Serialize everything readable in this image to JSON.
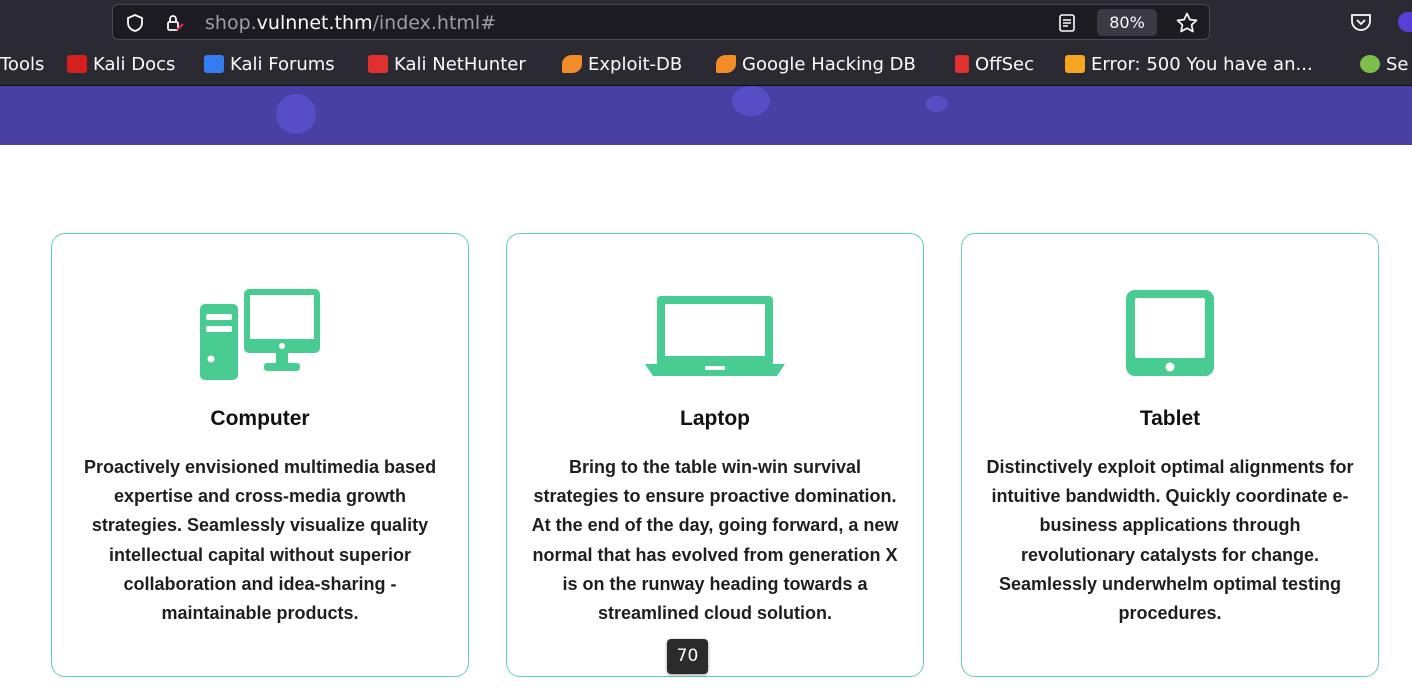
{
  "browser": {
    "url_prefix": "shop.",
    "url_domain": "vulnnet.thm",
    "url_path": "/index.html#",
    "zoom": "80%"
  },
  "bookmarks": [
    {
      "label": "Tools",
      "color": "#2b2a33"
    },
    {
      "label": "Kali Docs",
      "color": "#d6201f"
    },
    {
      "label": "Kali Forums",
      "color": "#367bf0"
    },
    {
      "label": "Kali NetHunter",
      "color": "#e03030"
    },
    {
      "label": "Exploit-DB",
      "color": "#f28c28"
    },
    {
      "label": "Google Hacking DB",
      "color": "#f28c28"
    },
    {
      "label": "OffSec",
      "color": "#e03030"
    },
    {
      "label": "Error: 500 You have an...",
      "color": "#f5a623"
    },
    {
      "label": "Se",
      "color": "#7cc04b"
    }
  ],
  "cards": [
    {
      "title": "Computer",
      "icon": "desktop-computer-icon",
      "description": "Proactively envisioned multimedia based expertise and cross-media growth strategies. Seamlessly visualize quality intellectual capital without superior collaboration and idea-sharing - maintainable products."
    },
    {
      "title": "Laptop",
      "icon": "laptop-icon",
      "description": "Bring to the table win-win survival strategies to ensure proactive domination. At the end of the day, going forward, a new normal that has evolved from generation X is on the runway heading towards a streamlined cloud solution."
    },
    {
      "title": "Tablet",
      "icon": "tablet-icon",
      "description": "Distinctively exploit optimal alignments for intuitive bandwidth. Quickly coordinate e-business applications through revolutionary catalysts for change. Seamlessly underwhelm optimal testing procedures."
    }
  ],
  "page_indicator": "70",
  "colors": {
    "accent": "#48cc92",
    "hero": "#4a40a4",
    "card_border": "#5fd4a6",
    "chrome": "#2b2a33"
  }
}
